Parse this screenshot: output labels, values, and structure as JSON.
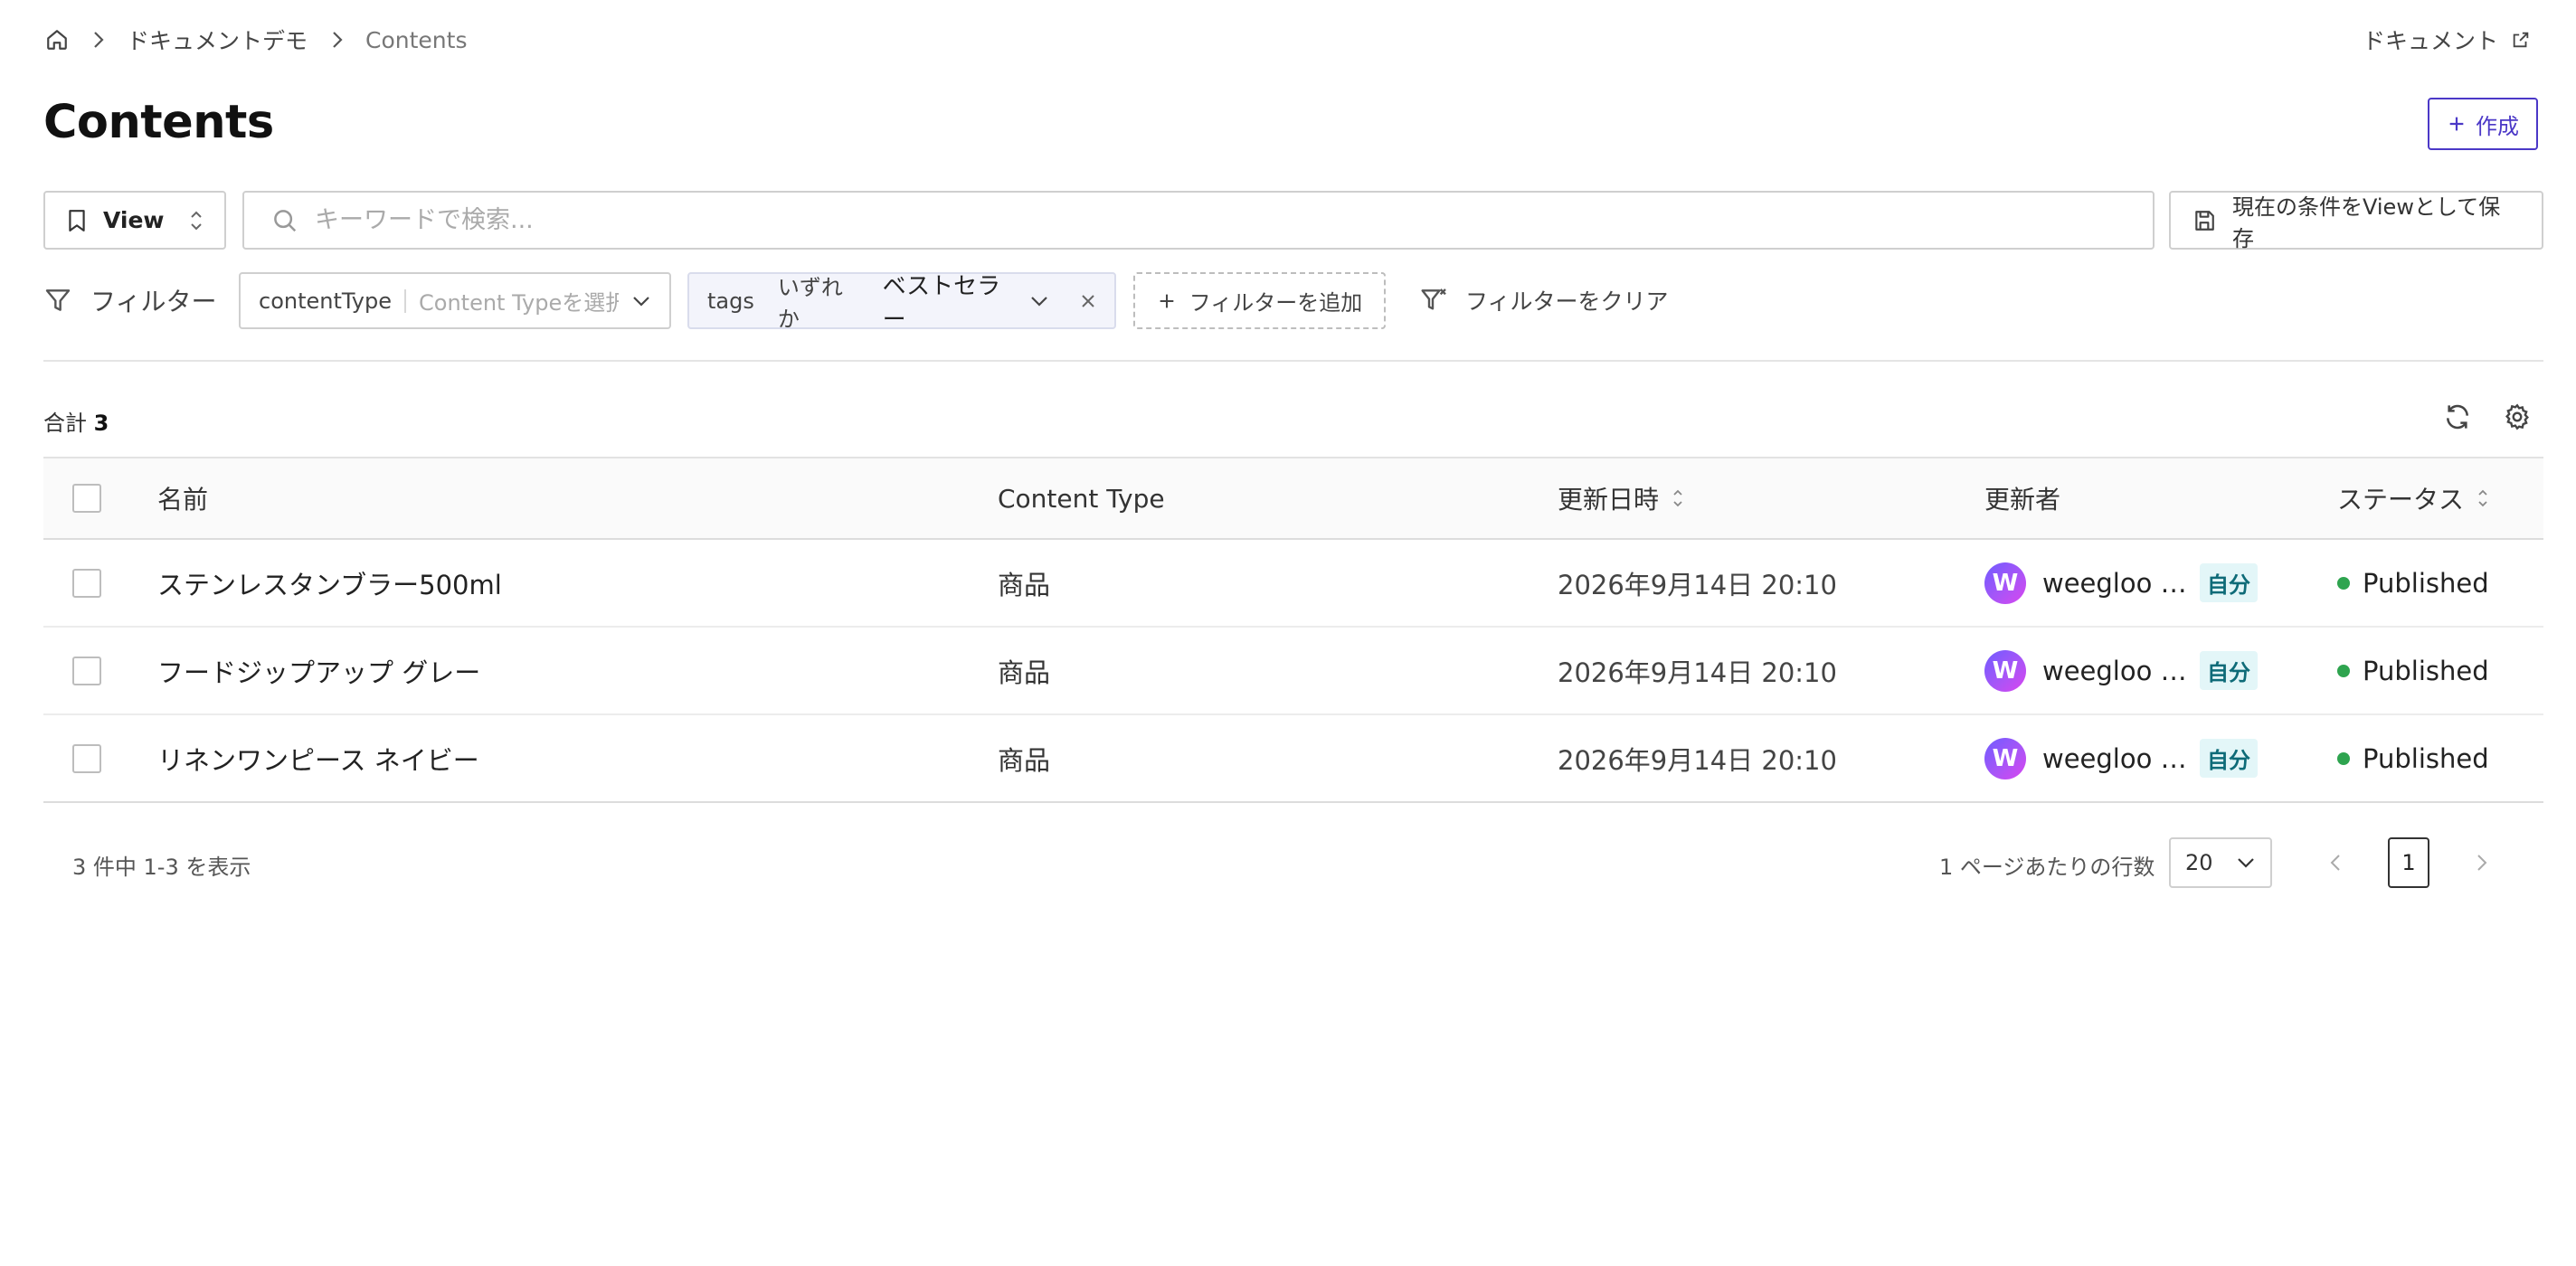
{
  "breadcrumb": {
    "home_icon": "home-icon",
    "items": [
      "ドキュメントデモ",
      "Contents"
    ]
  },
  "header": {
    "docs_link": "ドキュメント",
    "title": "Contents",
    "create_label": "作成"
  },
  "toolbar": {
    "view_label": "View",
    "search_placeholder": "キーワードで検索...",
    "save_view_label": "現在の条件をViewとして保存"
  },
  "filters": {
    "label": "フィルター",
    "content_type": {
      "key": "contentType",
      "placeholder": "Content Typeを選択"
    },
    "tags": {
      "key": "tags",
      "operator": "いずれか",
      "value": "ベストセラー"
    },
    "add_label": "フィルターを追加",
    "clear_label": "フィルターをクリア"
  },
  "summary": {
    "total_label": "合計",
    "total_count": "3"
  },
  "table": {
    "columns": {
      "name": "名前",
      "content_type": "Content Type",
      "updated_at": "更新日時",
      "updated_by": "更新者",
      "status": "ステータス"
    },
    "rows": [
      {
        "name": "ステンレスタンブラー500ml",
        "content_type": "商品",
        "updated_at": "2026年9月14日 20:10",
        "user": "weegloo …",
        "self_badge": "自分",
        "status": "Published",
        "avatar_letter": "W"
      },
      {
        "name": "フードジップアップ グレー",
        "content_type": "商品",
        "updated_at": "2026年9月14日 20:10",
        "user": "weegloo …",
        "self_badge": "自分",
        "status": "Published",
        "avatar_letter": "W"
      },
      {
        "name": "リネンワンピース ネイビー",
        "content_type": "商品",
        "updated_at": "2026年9月14日 20:10",
        "user": "weegloo …",
        "self_badge": "自分",
        "status": "Published",
        "avatar_letter": "W"
      }
    ]
  },
  "pagination": {
    "range_text": "3 件中 1-3 を表示",
    "rows_per_page_label": "1 ページあたりの行数",
    "rows_per_page_value": "20",
    "current_page": "1"
  },
  "colors": {
    "accent": "#4b38c7",
    "status_published": "#2ea44f",
    "self_badge_bg": "#e3f6f8"
  }
}
